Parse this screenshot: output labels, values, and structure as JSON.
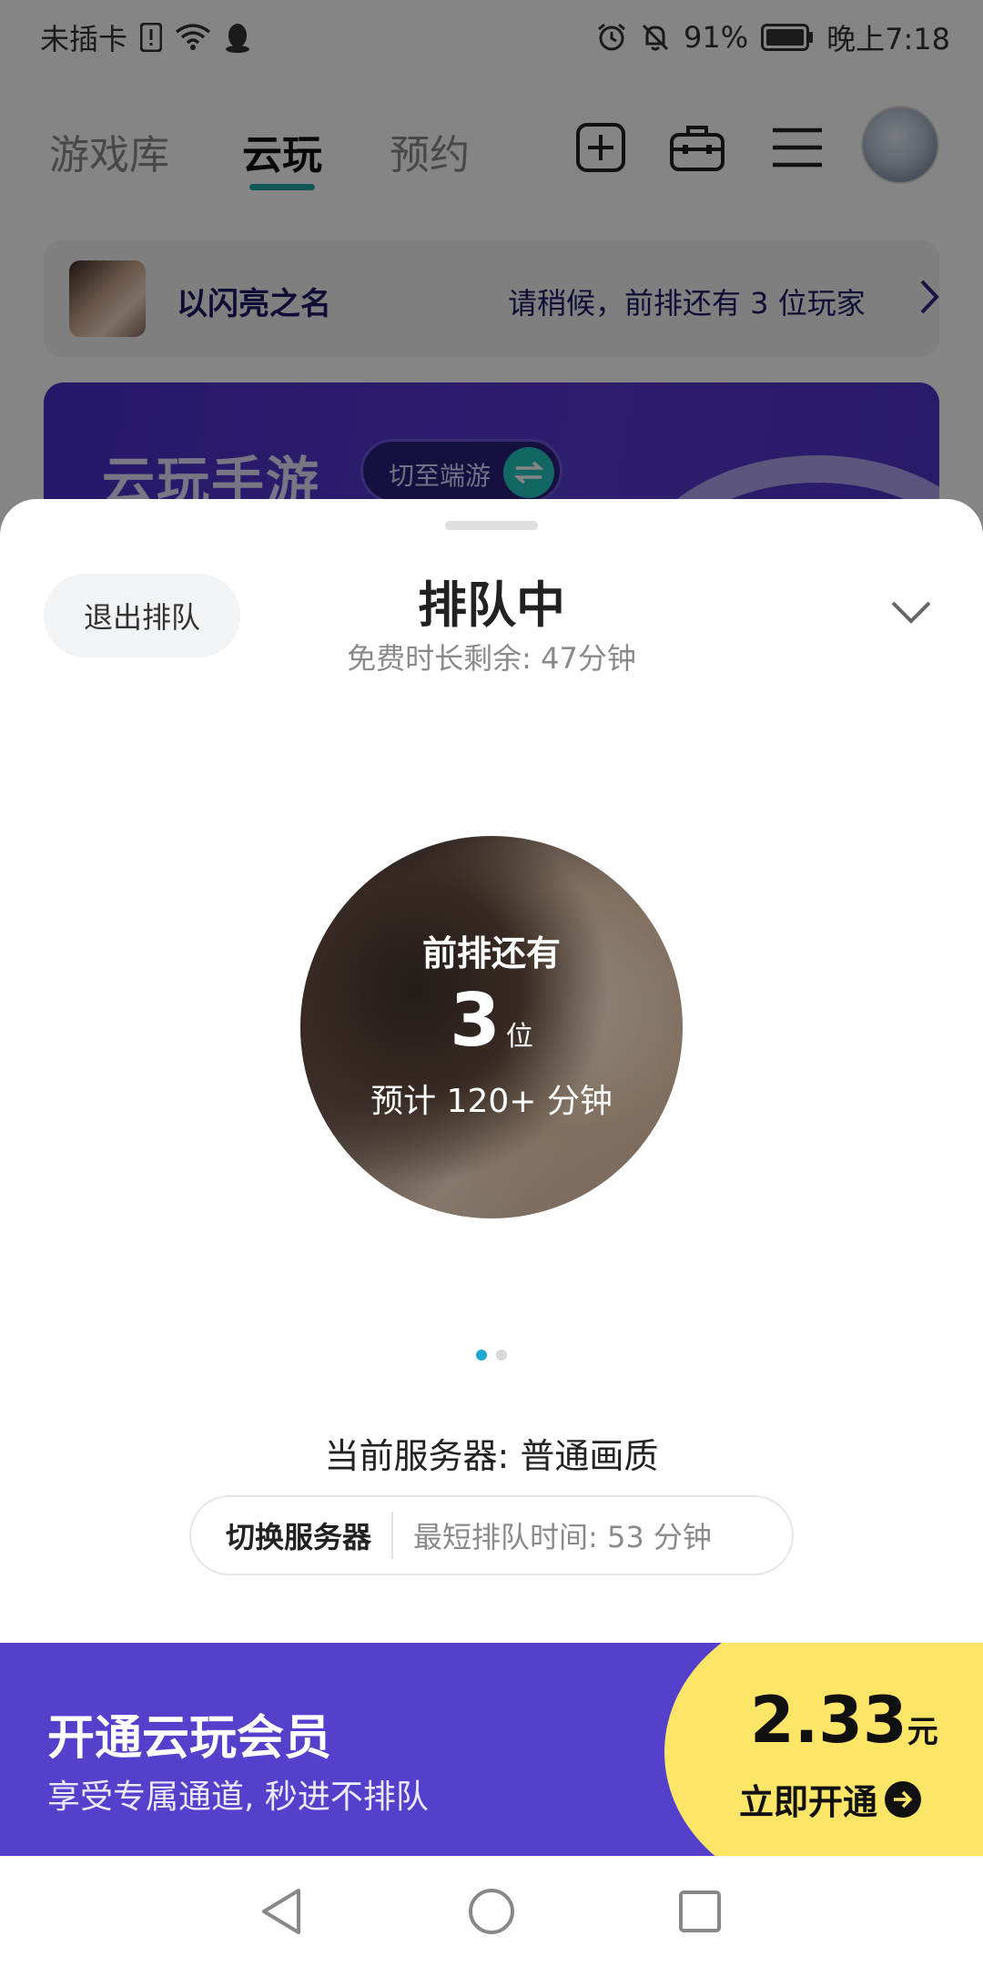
{
  "status_bar": {
    "carrier": "未插卡",
    "battery": "91%",
    "time": "晚上7:18",
    "icons": [
      "sim-alert-icon",
      "wifi-icon",
      "qq-icon",
      "alarm-icon",
      "mute-icon",
      "battery-icon"
    ]
  },
  "top_nav": {
    "tabs": [
      {
        "label": "游戏库",
        "active": false
      },
      {
        "label": "云玩",
        "active": true
      },
      {
        "label": "预约",
        "active": false
      }
    ],
    "accent_color": "#21a8a6",
    "icons": [
      "add-icon",
      "toolbox-icon",
      "menu-icon",
      "avatar"
    ]
  },
  "queue_card": {
    "game_name": "以闪亮之名",
    "status_text": "请稍候，前排还有 3 位玩家"
  },
  "banner": {
    "title": "云玩手游",
    "switch_label": "切至端游"
  },
  "sheet": {
    "exit_label": "退出排队",
    "title": "排队中",
    "subtitle": "免费时长剩余: 47分钟",
    "queue_label": "前排还有",
    "queue_count": "3",
    "queue_unit": "位",
    "eta_text": "预计 120+ 分钟",
    "page_indicator": {
      "total": 2,
      "active": 1
    },
    "server_label": "当前服务器: 普通画质",
    "switch_server_label": "切换服务器",
    "shortest_wait": "最短排队时间: 53 分钟"
  },
  "membership": {
    "title": "开通云玩会员",
    "subtitle": "享受专属通道, 秒进不排队",
    "price": "2.33",
    "price_unit": "元",
    "buy_label": "立即开通",
    "bg_color": "#5540cc",
    "highlight_color": "#fde568"
  },
  "nav_bar": {
    "icons": [
      "back-icon",
      "home-icon",
      "recents-icon"
    ]
  }
}
